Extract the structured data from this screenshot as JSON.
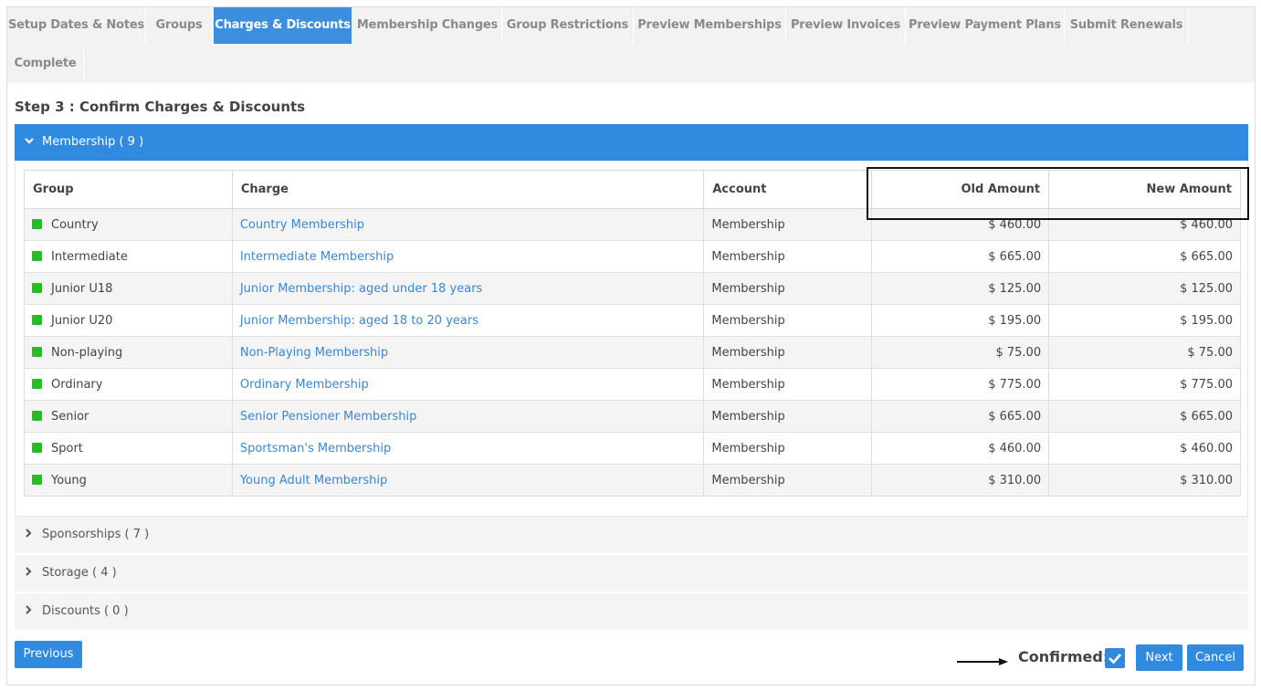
{
  "tabs": [
    {
      "label": "Setup Dates & Notes",
      "active": false
    },
    {
      "label": "Groups",
      "active": false
    },
    {
      "label": "Charges & Discounts",
      "active": true
    },
    {
      "label": "Membership Changes",
      "active": false
    },
    {
      "label": "Group Restrictions",
      "active": false
    },
    {
      "label": "Preview Memberships",
      "active": false
    },
    {
      "label": "Preview Invoices",
      "active": false
    },
    {
      "label": "Preview Payment Plans",
      "active": false
    },
    {
      "label": "Submit Renewals",
      "active": false
    },
    {
      "label": "Complete",
      "active": false
    }
  ],
  "step_title": "Step 3 : Confirm Charges & Discounts",
  "membership_panel": {
    "label": "Membership ( 9 )",
    "expanded": true,
    "columns": [
      "Group",
      "Charge",
      "Account",
      "Old Amount",
      "New Amount"
    ],
    "rows": [
      {
        "group": "Country",
        "charge": "Country Membership",
        "account": "Membership",
        "old": "$ 460.00",
        "new": "$ 460.00"
      },
      {
        "group": "Intermediate",
        "charge": "Intermediate Membership",
        "account": "Membership",
        "old": "$ 665.00",
        "new": "$ 665.00"
      },
      {
        "group": "Junior U18",
        "charge": "Junior Membership: aged under 18 years",
        "account": "Membership",
        "old": "$ 125.00",
        "new": "$ 125.00"
      },
      {
        "group": "Junior U20",
        "charge": "Junior Membership: aged 18 to 20 years",
        "account": "Membership",
        "old": "$ 195.00",
        "new": "$ 195.00"
      },
      {
        "group": "Non-playing",
        "charge": "Non-Playing Membership",
        "account": "Membership",
        "old": "$ 75.00",
        "new": "$ 75.00"
      },
      {
        "group": "Ordinary",
        "charge": "Ordinary Membership",
        "account": "Membership",
        "old": "$ 775.00",
        "new": "$ 775.00"
      },
      {
        "group": "Senior",
        "charge": "Senior Pensioner Membership",
        "account": "Membership",
        "old": "$ 665.00",
        "new": "$ 665.00"
      },
      {
        "group": "Sport",
        "charge": "Sportsman's Membership",
        "account": "Membership",
        "old": "$ 460.00",
        "new": "$ 460.00"
      },
      {
        "group": "Young",
        "charge": "Young Adult Membership",
        "account": "Membership",
        "old": "$ 310.00",
        "new": "$ 310.00"
      }
    ]
  },
  "collapsed_panels": [
    {
      "label": "Sponsorships ( 7 )"
    },
    {
      "label": "Storage ( 4 )"
    },
    {
      "label": "Discounts ( 0 )"
    }
  ],
  "footer": {
    "previous_label": "Previous",
    "confirmed_label": "Confirmed:",
    "confirmed_checked": true,
    "next_label": "Next",
    "cancel_label": "Cancel"
  },
  "colors": {
    "accent": "#2f8ae0",
    "status_active": "#21c021",
    "link": "#3a86d4"
  },
  "icons": {
    "expanded": "chevron-down-icon",
    "collapsed": "chevron-right-icon",
    "check": "check-icon",
    "annotation": "arrow-right-icon"
  }
}
